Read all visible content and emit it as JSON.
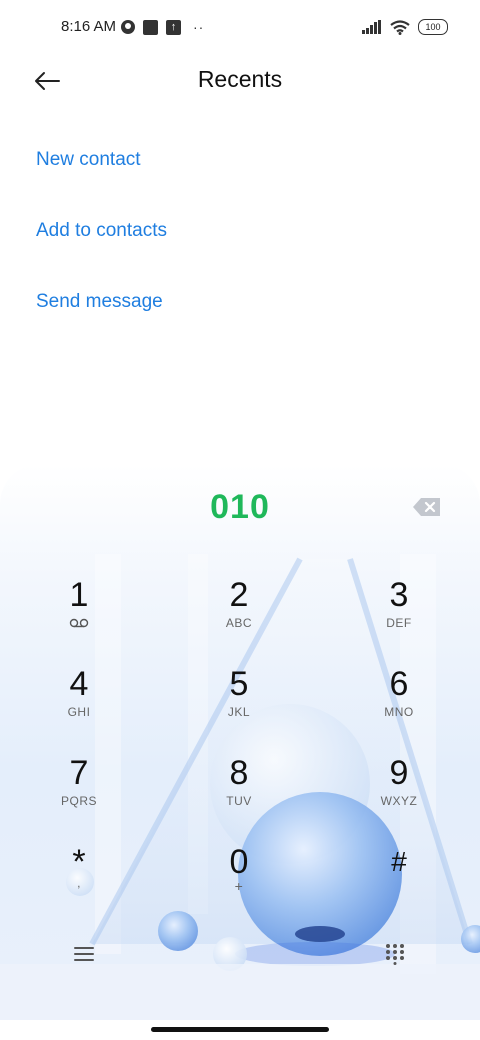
{
  "status_bar": {
    "time": "8:16 AM",
    "dots": "··",
    "battery": "100"
  },
  "header": {
    "title": "Recents"
  },
  "actions": {
    "new_contact": "New contact",
    "add_to_contacts": "Add to contacts",
    "send_message": "Send message"
  },
  "dialpad": {
    "number": "010",
    "keys": [
      {
        "digit": "1",
        "letters": ""
      },
      {
        "digit": "2",
        "letters": "ABC"
      },
      {
        "digit": "3",
        "letters": "DEF"
      },
      {
        "digit": "4",
        "letters": "GHI"
      },
      {
        "digit": "5",
        "letters": "JKL"
      },
      {
        "digit": "6",
        "letters": "MNO"
      },
      {
        "digit": "7",
        "letters": "PQRS"
      },
      {
        "digit": "8",
        "letters": "TUV"
      },
      {
        "digit": "9",
        "letters": "WXYZ"
      },
      {
        "digit": "*",
        "letters": ","
      },
      {
        "digit": "0",
        "letters": "+"
      },
      {
        "digit": "#",
        "letters": ""
      }
    ]
  },
  "colors": {
    "accent": "#1f7ee0",
    "number_green": "#1fb85a"
  },
  "icons": {
    "back": "arrow-left-icon",
    "backspace": "backspace-icon",
    "voicemail": "voicemail-icon",
    "menu": "menu-icon",
    "dialpad": "dialpad-grid-icon"
  }
}
